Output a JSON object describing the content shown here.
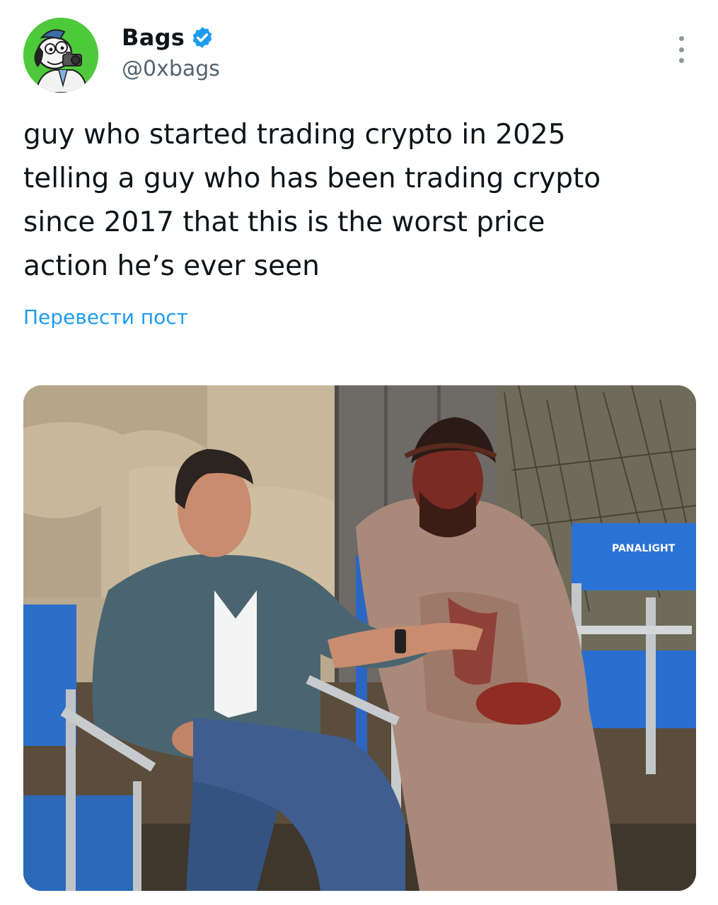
{
  "author": {
    "display_name": "Bags",
    "handle": "@0xbags",
    "verified": true,
    "avatar_icon": "cartoon-dog-avatar",
    "avatar_bg": "#4fc93c"
  },
  "tweet": {
    "text": "guy who started trading crypto in 2025\ntelling a guy who has been trading crypto\nsince 2017 that this is the worst price\naction he’s ever seen",
    "translate_label": "Перевести пост"
  },
  "media": {
    "chair_label": "PANALIGHT"
  },
  "colors": {
    "accent": "#1d9bf0",
    "text_primary": "#0f1419",
    "text_secondary": "#536471"
  },
  "icons": {
    "verified": "verified-badge-icon",
    "more": "more-options-icon"
  }
}
